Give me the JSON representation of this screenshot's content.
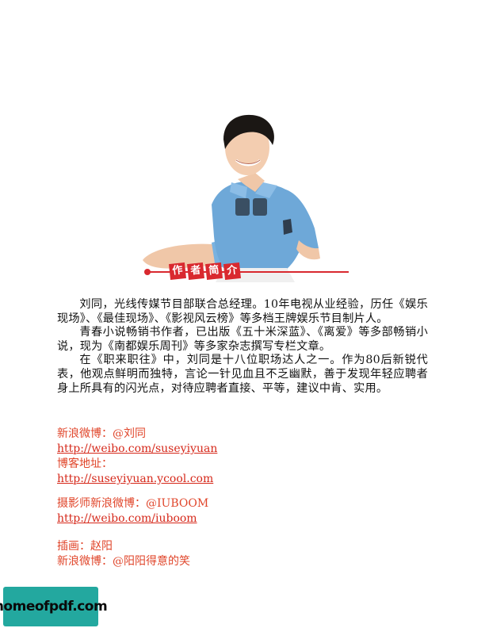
{
  "banner": {
    "chars": [
      "作",
      "者",
      "简",
      "介"
    ]
  },
  "bio": {
    "p1": "刘同，光线传媒节目部联合总经理。10年电视从业经验，历任《娱乐现场》、《最佳现场》、《影视风云榜》等多档王牌娱乐节目制片人。",
    "p2": "青春小说畅销书作者，已出版《五十米深蓝》、《离爱》等多部畅销小说，现为《南都娱乐周刊》等多家杂志撰写专栏文章。",
    "p3": "在《职来职往》中，刘同是十八位职场达人之一。作为80后新锐代表，他观点鲜明而独特，言论一针见血且不乏幽默，善于发现年轻应聘者身上所具有的闪光点，对待应聘者直接、平等，建议中肯、实用。"
  },
  "links": {
    "weibo_label": "新浪微博：@刘同",
    "weibo_url": "http://weibo.com/suseyiyuan",
    "blog_label": "博客地址：",
    "blog_url": "http://suseyiyuan.ycool.com",
    "photographer_label": "摄影师新浪微博：@IUBOOM",
    "photographer_url": "http://weibo.com/iuboom",
    "illustrator_label": "插画：赵阳",
    "illustrator_weibo": "新浪微博：@阳阳得意的笑"
  },
  "watermark": {
    "text": "homeofpdf.com"
  },
  "colors": {
    "accent": "#d9292f",
    "link": "#d6291b",
    "shirt": "#6ea8d8",
    "watermark_bg": "#23a89f"
  }
}
